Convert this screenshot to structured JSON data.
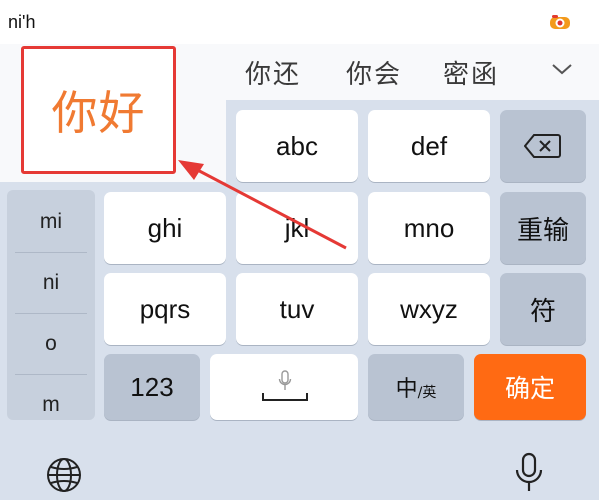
{
  "input_line": {
    "composing_text": "ni'h",
    "logo_icon": "app-logo-icon"
  },
  "candidates": [
    "你还",
    "你会",
    "密函"
  ],
  "expand_icon": "chevron-down-icon",
  "highlight": {
    "text": "你好",
    "border_color": "#e53935",
    "text_color": "#f07a32"
  },
  "keyboard": {
    "row1": {
      "k1": "abc",
      "k2": "def",
      "backspace_icon": "backspace-icon"
    },
    "row2": {
      "k1": "ghi",
      "k2": "jkl",
      "k3": "mno",
      "reenter": "重输"
    },
    "row3": {
      "k1": "pqrs",
      "k2": "tuv",
      "k3": "wxyz",
      "symbol": "符"
    },
    "row4": {
      "numbers": "123",
      "lang_main": "中",
      "lang_sub": "/英",
      "confirm": "确定"
    },
    "pinyin_options": [
      "mi",
      "ni",
      "o",
      "m"
    ],
    "accent_color": "#ff6a13"
  },
  "bottom": {
    "globe_icon": "globe-icon",
    "mic_icon": "microphone-icon"
  }
}
